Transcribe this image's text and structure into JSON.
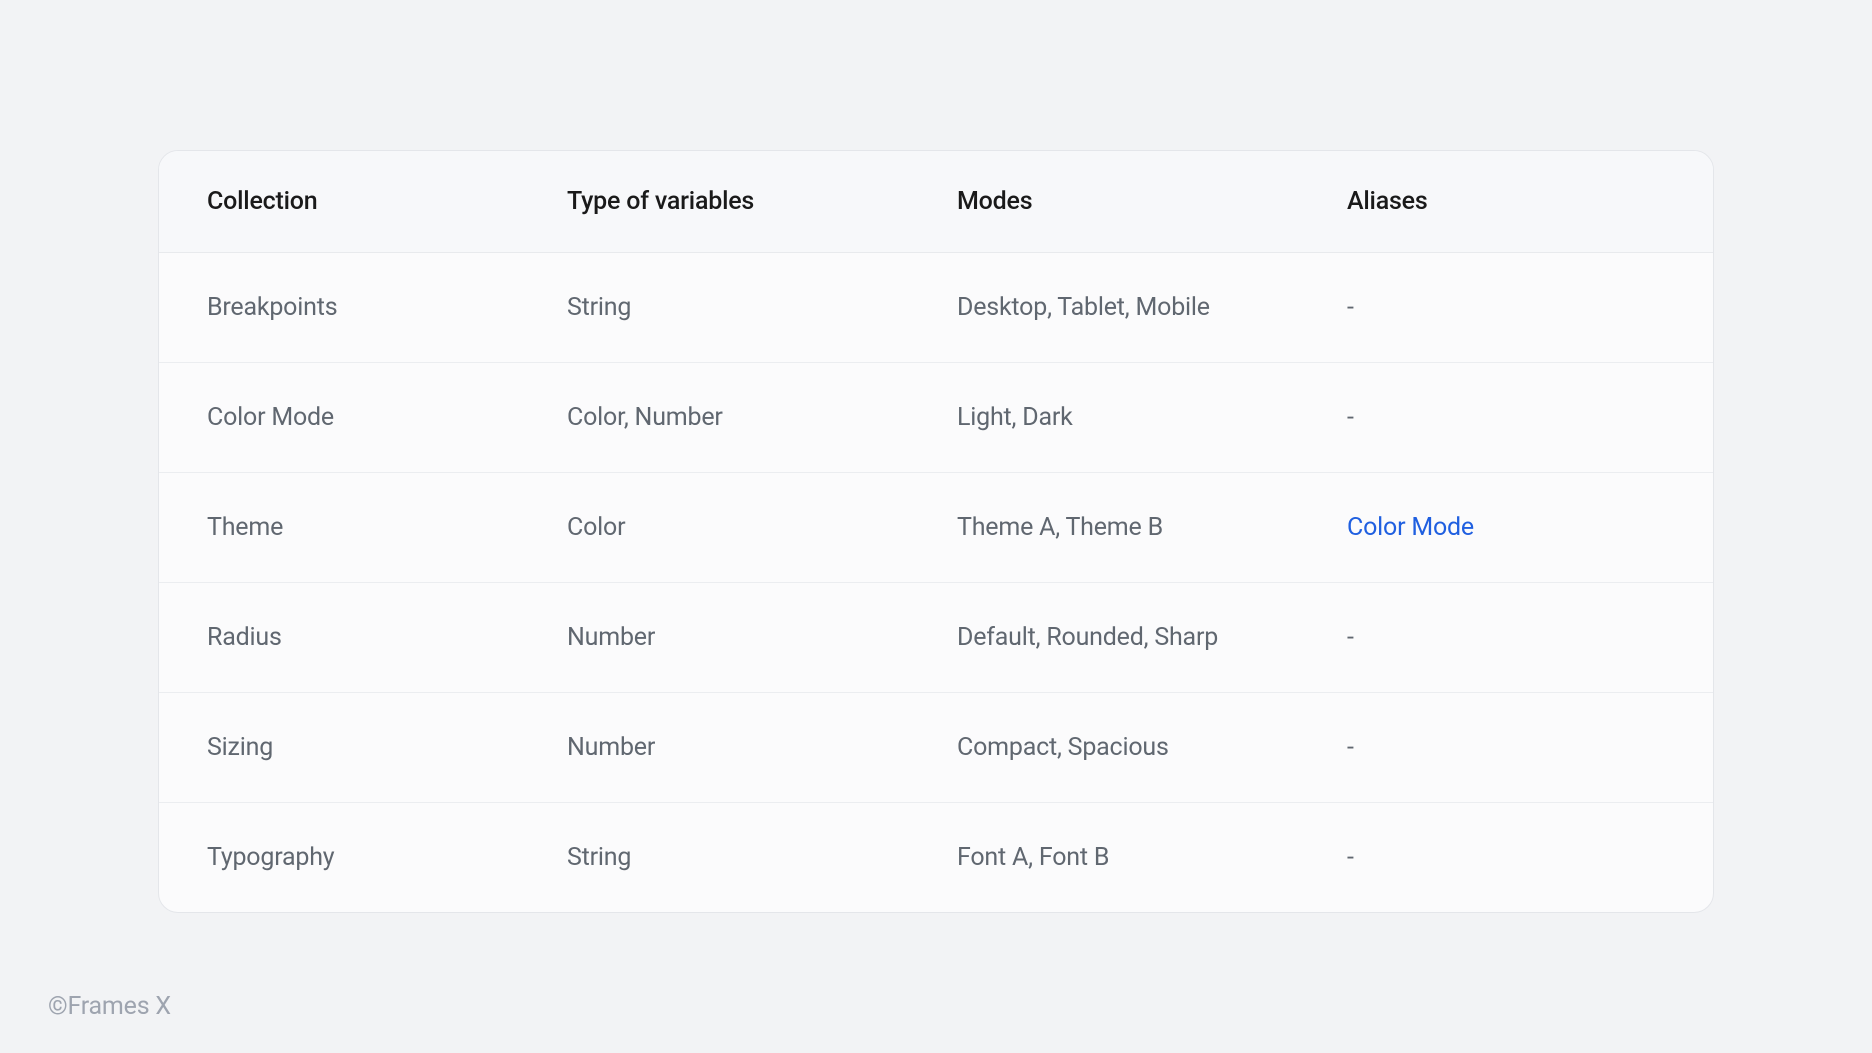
{
  "table": {
    "headers": {
      "collection": "Collection",
      "type": "Type of variables",
      "modes": "Modes",
      "aliases": "Aliases"
    },
    "rows": [
      {
        "collection": "Breakpoints",
        "type": "String",
        "modes": "Desktop, Tablet, Mobile",
        "aliases": "-",
        "aliasLink": false
      },
      {
        "collection": "Color Mode",
        "type": "Color, Number",
        "modes": "Light, Dark",
        "aliases": "-",
        "aliasLink": false
      },
      {
        "collection": "Theme",
        "type": "Color",
        "modes": "Theme A, Theme B",
        "aliases": "Color Mode",
        "aliasLink": true
      },
      {
        "collection": "Radius",
        "type": "Number",
        "modes": "Default, Rounded, Sharp",
        "aliases": "-",
        "aliasLink": false
      },
      {
        "collection": "Sizing",
        "type": "Number",
        "modes": "Compact, Spacious",
        "aliases": "-",
        "aliasLink": false
      },
      {
        "collection": "Typography",
        "type": "String",
        "modes": "Font A, Font B",
        "aliases": "-",
        "aliasLink": false
      }
    ]
  },
  "footer": {
    "credit": "©Frames X"
  }
}
